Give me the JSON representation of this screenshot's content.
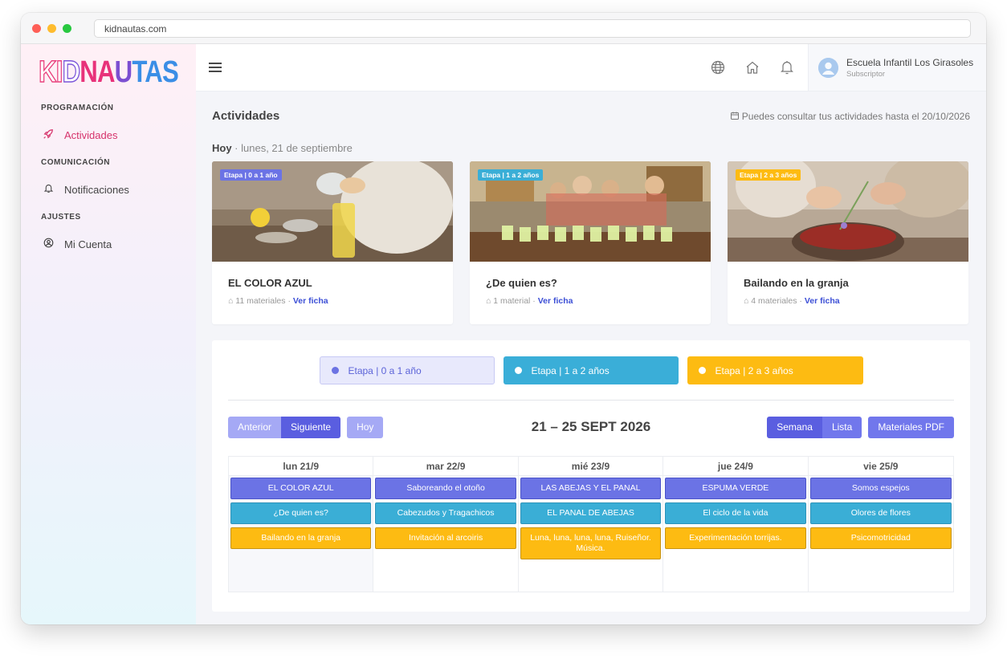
{
  "browser": {
    "url": "kidnautas.com"
  },
  "logo": {
    "text": "KIDNAUTAS"
  },
  "sidebar": {
    "sections": [
      {
        "label": "PROGRAMACIÓN",
        "items": [
          {
            "label": "Actividades",
            "icon": "rocket-icon",
            "active": true
          }
        ]
      },
      {
        "label": "COMUNICACIÓN",
        "items": [
          {
            "label": "Notificaciones",
            "icon": "bell-icon"
          }
        ]
      },
      {
        "label": "AJUSTES",
        "items": [
          {
            "label": "Mi Cuenta",
            "icon": "user-circle-icon"
          }
        ]
      }
    ]
  },
  "topbar": {
    "icons": [
      "globe-icon",
      "home-icon",
      "bell-icon"
    ],
    "user": {
      "name": "Escuela Infantil Los Girasoles",
      "role": "Subscriptor"
    }
  },
  "page": {
    "title": "Actividades",
    "notice": "Puedes consultar tus actividades hasta el 20/10/2026",
    "today_label": "Hoy",
    "today_date": " · lunes, 21 de septiembre"
  },
  "cards": [
    {
      "badge": "Etapa | 0 a 1 año",
      "title": "EL COLOR AZUL",
      "materials": "11 materiales",
      "link": "Ver ficha"
    },
    {
      "badge": "Etapa | 1 a 2 años",
      "title": "¿De quien es?",
      "materials": "1 material",
      "link": "Ver ficha"
    },
    {
      "badge": "Etapa | 2 a 3 años",
      "title": "Bailando en la granja",
      "materials": "4 materiales",
      "link": "Ver ficha"
    }
  ],
  "legend": [
    "Etapa | 0 a 1 año",
    "Etapa | 1 a 2 años",
    "Etapa | 2 a 3 años"
  ],
  "calendar": {
    "prev": "Anterior",
    "next": "Siguiente",
    "today": "Hoy",
    "range": "21 – 25 SEPT 2026",
    "view_week": "Semana",
    "view_list": "Lista",
    "pdf": "Materiales PDF",
    "days": [
      {
        "label": "lun 21/9",
        "events": [
          "EL COLOR AZUL",
          "¿De quien es?",
          "Bailando en la granja"
        ]
      },
      {
        "label": "mar 22/9",
        "events": [
          "Saboreando el otoño",
          "Cabezudos y Tragachicos",
          "Invitación al arcoiris"
        ]
      },
      {
        "label": "mié 23/9",
        "events": [
          "LAS ABEJAS Y EL PANAL",
          "EL PANAL DE ABEJAS",
          "Luna, luna, luna, luna, Ruiseñor. Música."
        ]
      },
      {
        "label": "jue 24/9",
        "events": [
          "ESPUMA VERDE",
          "El ciclo de la vida",
          "Experimentación torrijas."
        ]
      },
      {
        "label": "vie 25/9",
        "events": [
          "Somos espejos",
          "Olores de flores",
          "Psicomotricidad"
        ]
      }
    ]
  },
  "colors": {
    "stage0": "#6b73e5",
    "stage1": "#3aaed6",
    "stage2": "#fdbb12",
    "active": "#d6336c"
  }
}
